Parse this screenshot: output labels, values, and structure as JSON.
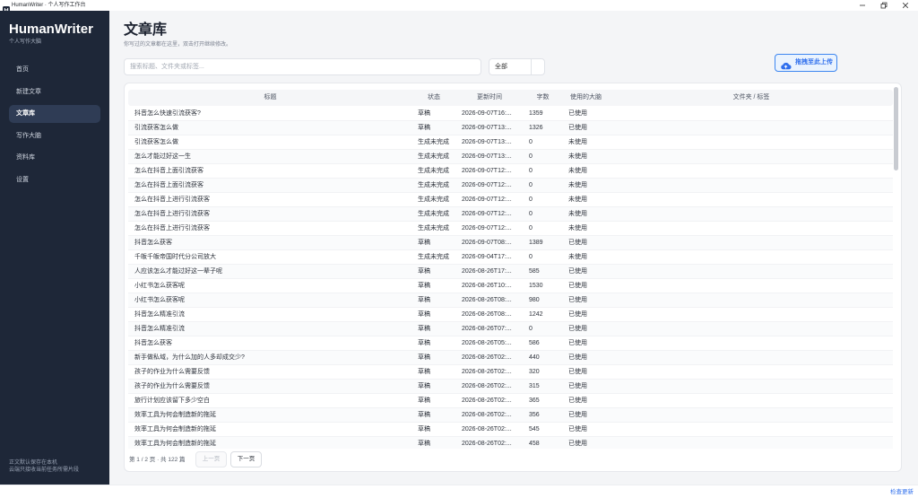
{
  "window": {
    "title": "HumanWriter · 个人写作工作台",
    "icon": "app-logo-icon",
    "controls": {
      "minimize": "minimize-icon",
      "restore": "restore-icon",
      "close": "close-icon"
    }
  },
  "colors": {
    "sidebar_bg": "#1e2738",
    "nav_active_bg": "#2f3c55",
    "accent": "#2f6fed",
    "page_bg": "#f4f5f7"
  },
  "sidebar": {
    "brand": "HumanWriter",
    "tagline": "个人写作大脑",
    "items": [
      {
        "label": "首页",
        "active": false
      },
      {
        "label": "新建文章",
        "active": false
      },
      {
        "label": "文章库",
        "active": true
      },
      {
        "label": "写作大脑",
        "active": false
      },
      {
        "label": "资料库",
        "active": false
      },
      {
        "label": "设置",
        "active": false
      }
    ],
    "footer": [
      "正文默认保存在本机",
      "云端只接收当前任务所需片段"
    ]
  },
  "page": {
    "title": "文章库",
    "subtitle": "你写过的文章都在这里，双击打开继续修改。"
  },
  "search": {
    "placeholder": "搜索标题、文件夹或标签...",
    "value": ""
  },
  "filter": {
    "selected": "全部"
  },
  "upload": {
    "label": "拖拽至此上传",
    "icon": "cloud-upload-icon"
  },
  "table": {
    "columns": [
      "标题",
      "状态",
      "更新时间",
      "字数",
      "使用的大脑",
      "文件夹 / 标签"
    ],
    "scrollbar": {
      "offset_fraction": 0,
      "visible_fraction": 0.23
    },
    "rows": [
      {
        "title": "抖音怎么快速引流获客?",
        "status": "草稿",
        "updated": "2026-09-07T16:...",
        "words": 1359,
        "brain": "已使用"
      },
      {
        "title": "引流获客怎么做",
        "status": "草稿",
        "updated": "2026-09-07T13:...",
        "words": 1326,
        "brain": "已使用"
      },
      {
        "title": "引流获客怎么做",
        "status": "生成未完成",
        "updated": "2026-09-07T13:...",
        "words": 0,
        "brain": "未使用"
      },
      {
        "title": "怎么才能过好这一生",
        "status": "生成未完成",
        "updated": "2026-09-07T13:...",
        "words": 0,
        "brain": "未使用"
      },
      {
        "title": "怎么在抖音上面引流获客",
        "status": "生成未完成",
        "updated": "2026-09-07T12:...",
        "words": 0,
        "brain": "未使用"
      },
      {
        "title": "怎么在抖音上面引流获客",
        "status": "生成未完成",
        "updated": "2026-09-07T12:...",
        "words": 0,
        "brain": "未使用"
      },
      {
        "title": "怎么在抖音上进行引流获客",
        "status": "生成未完成",
        "updated": "2026-09-07T12:...",
        "words": 0,
        "brain": "未使用"
      },
      {
        "title": "怎么在抖音上进行引流获客",
        "status": "生成未完成",
        "updated": "2026-09-07T12:...",
        "words": 0,
        "brain": "未使用"
      },
      {
        "title": "怎么在抖音上进行引流获客",
        "status": "生成未完成",
        "updated": "2026-09-07T12:...",
        "words": 0,
        "brain": "未使用"
      },
      {
        "title": "抖音怎么获客",
        "status": "草稿",
        "updated": "2026-09-07T08:...",
        "words": 1389,
        "brain": "已使用"
      },
      {
        "title": "千皈千皈帝国时代分公司放大",
        "status": "生成未完成",
        "updated": "2026-09-04T17:...",
        "words": 0,
        "brain": "未使用"
      },
      {
        "title": "人应该怎么才能过好这一辈子呢",
        "status": "草稿",
        "updated": "2026-08-26T17:...",
        "words": 585,
        "brain": "已使用"
      },
      {
        "title": "小红书怎么获客呢",
        "status": "草稿",
        "updated": "2026-08-26T10:...",
        "words": 1530,
        "brain": "已使用"
      },
      {
        "title": "小红书怎么获客呢",
        "status": "草稿",
        "updated": "2026-08-26T08:...",
        "words": 980,
        "brain": "已使用"
      },
      {
        "title": "抖音怎么精准引流",
        "status": "草稿",
        "updated": "2026-08-26T08:...",
        "words": 1242,
        "brain": "已使用"
      },
      {
        "title": "抖音怎么精准引流",
        "status": "草稿",
        "updated": "2026-08-26T07:...",
        "words": 0,
        "brain": "已使用"
      },
      {
        "title": "抖音怎么获客",
        "status": "草稿",
        "updated": "2026-08-26T05:...",
        "words": 586,
        "brain": "已使用"
      },
      {
        "title": "新手做私域，为什么加的人多却成交少?",
        "status": "草稿",
        "updated": "2026-08-26T02:...",
        "words": 440,
        "brain": "已使用"
      },
      {
        "title": "孩子的作业为什么需要反馈",
        "status": "草稿",
        "updated": "2026-08-26T02:...",
        "words": 320,
        "brain": "已使用"
      },
      {
        "title": "孩子的作业为什么需要反馈",
        "status": "草稿",
        "updated": "2026-08-26T02:...",
        "words": 315,
        "brain": "已使用"
      },
      {
        "title": "旅行计划应该留下多少空白",
        "status": "草稿",
        "updated": "2026-08-26T02:...",
        "words": 365,
        "brain": "已使用"
      },
      {
        "title": "效率工具为何会制造新的拖延",
        "status": "草稿",
        "updated": "2026-08-26T02:...",
        "words": 356,
        "brain": "已使用"
      },
      {
        "title": "效率工具为何会制造新的拖延",
        "status": "草稿",
        "updated": "2026-08-26T02:...",
        "words": 545,
        "brain": "已使用"
      },
      {
        "title": "效率工具为何会制造新的拖延",
        "status": "草稿",
        "updated": "2026-08-26T02:...",
        "words": 458,
        "brain": "已使用"
      }
    ]
  },
  "pagination": {
    "info": "第 1 / 2 页 · 共 122 篇",
    "prev_label": "上一页",
    "next_label": "下一页",
    "prev_disabled": true
  },
  "statusbar": {
    "update_link": "检查更新"
  }
}
